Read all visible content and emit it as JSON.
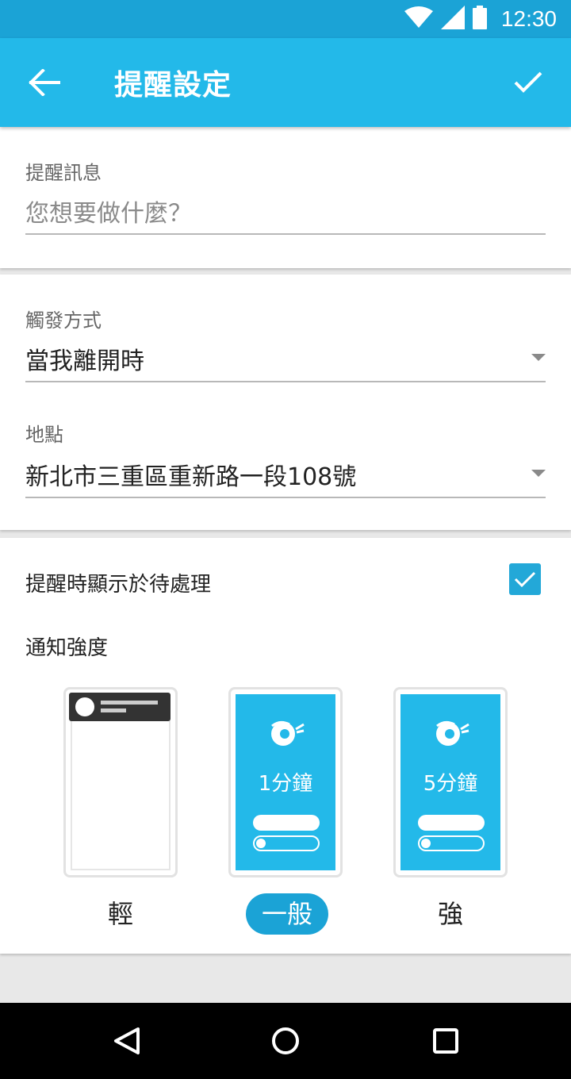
{
  "status_bar": {
    "time": "12:30",
    "icons": [
      "wifi-icon",
      "signal-icon",
      "battery-icon"
    ]
  },
  "app_bar": {
    "title": "提醒設定",
    "back_icon": "arrow-left-icon",
    "confirm_icon": "check-icon",
    "color": "#23b9e9"
  },
  "message": {
    "label": "提醒訊息",
    "placeholder": "您想要做什麼？",
    "value": ""
  },
  "trigger": {
    "label": "觸發方式",
    "value": "當我離開時"
  },
  "location": {
    "label": "地點",
    "value": "新北市三重區重新路一段108號"
  },
  "show_pending": {
    "label": "提醒時顯示於待處理",
    "checked": true
  },
  "intensity": {
    "label": "通知強度",
    "options": [
      {
        "label": "輕",
        "selected": false
      },
      {
        "label": "一般",
        "minutes": "1分鐘",
        "selected": true
      },
      {
        "label": "強",
        "minutes": "5分鐘",
        "selected": false
      }
    ]
  },
  "nav_bar": {
    "icons": [
      "back-triangle-icon",
      "home-circle-icon",
      "recents-square-icon"
    ]
  }
}
